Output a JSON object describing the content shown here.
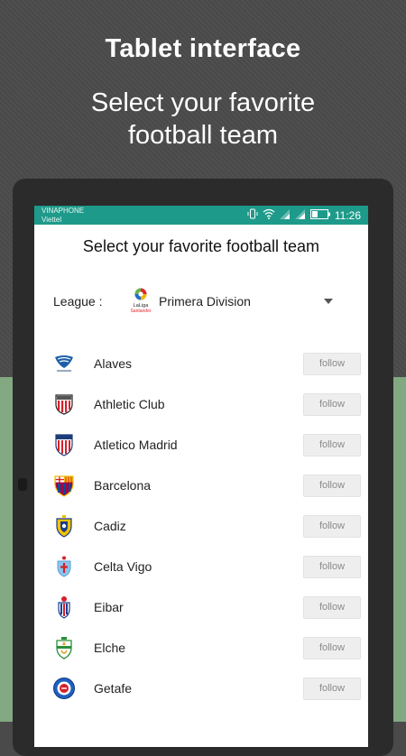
{
  "promo": {
    "title": "Tablet interface",
    "subtitle_line1": "Select your favorite",
    "subtitle_line2": "football team"
  },
  "statusbar": {
    "carrier": "VINAPHONE",
    "carrier2": "Viettel",
    "time": "11:26",
    "icons": [
      "vibrate-icon",
      "wifi-icon",
      "signal-icon",
      "signal-icon",
      "battery-icon"
    ]
  },
  "screen": {
    "title": "Select your favorite football team",
    "league": {
      "label": "League :",
      "logo_text_top": "LaLiga",
      "logo_text_bottom": "Santander",
      "value": "Primera Division"
    },
    "follow_label": "follow",
    "teams": [
      {
        "name": "Alaves"
      },
      {
        "name": "Athletic Club"
      },
      {
        "name": "Atletico Madrid"
      },
      {
        "name": "Barcelona"
      },
      {
        "name": "Cadiz"
      },
      {
        "name": "Celta Vigo"
      },
      {
        "name": "Eibar"
      },
      {
        "name": "Elche"
      },
      {
        "name": "Getafe"
      }
    ]
  },
  "colors": {
    "statusbar": "#1e9a8a",
    "background_top": "#4b4b4b",
    "background_bottom": "#82a982"
  }
}
